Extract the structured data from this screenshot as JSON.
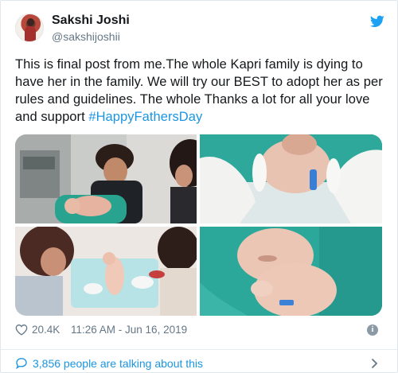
{
  "tweet": {
    "author_name": "Sakshi Joshi",
    "author_handle": "@sakshijoshii",
    "text_main": "This is final post from me.The whole Kapri family is dying to have her in the family. We will try our BEST to adopt her as per rules and guidelines. The whole Thanks a lot for all your love and support ",
    "hashtag": "#HappyFathersDay",
    "likes": "20.4K",
    "timestamp": "11:26 AM - Jun 16, 2019",
    "talking": "3,856 people are talking about this"
  },
  "icons": {
    "brand": "twitter-bird-icon",
    "like": "heart-icon",
    "info": "info-icon",
    "reply": "speech-bubble-icon",
    "more": "chevron-right-icon"
  },
  "colors": {
    "link": "#1b95e0",
    "muted": "#657786",
    "text": "#14171a"
  }
}
